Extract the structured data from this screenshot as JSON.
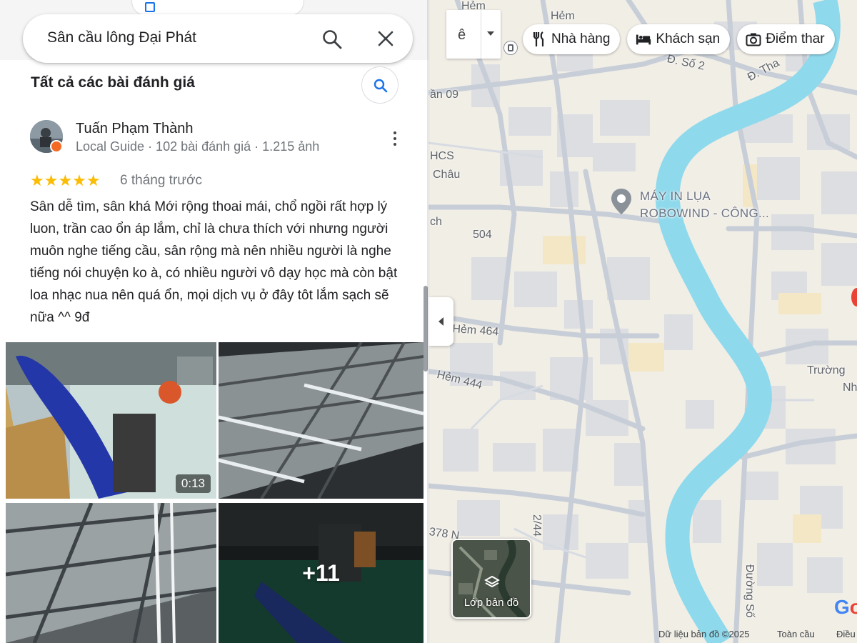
{
  "search": {
    "value": "Sân cầu lông Đại Phát"
  },
  "peek_tab_label": "",
  "reviews": {
    "section_title": "Tất cả các bài đánh giá",
    "review": {
      "author": "Tuấn Phạm Thành",
      "meta": "Local Guide · 102 bài đánh giá · 1.215 ảnh",
      "rating": 5,
      "stars": "★★★★★",
      "date": "6 tháng trước",
      "text": "Sân dễ tìm, sân khá Mới rộng thoai mái, chổ ngồi rất hợp lý luon, trần cao ổn áp lắm, chỉ là chưa thích với nhưng người muôn nghe tiếng cầu, sân rộng mà nên nhiều người là nghe tiếng nói chuyện ko à, có nhiều người vô dạy học mà còn bật loa nhạc nua nên quá ổn, mọi dịch vụ ở đây tôt lắm sạch sẽ nữa ^^ 9đ",
      "photos": {
        "video_duration": "0:13",
        "more_count": "+11"
      }
    }
  },
  "map": {
    "lang_button": "ê",
    "chips": [
      {
        "label": "Nhà hàng",
        "icon": "restaurant-icon"
      },
      {
        "label": "Khách sạn",
        "icon": "hotel-icon"
      },
      {
        "label": "Điểm thar",
        "icon": "camera-icon"
      }
    ],
    "poi_label_line1": "MÁY IN LỤA",
    "poi_label_line2": "ROBOWIND - CÔNG...",
    "labels": {
      "hem_top": "Hẻm",
      "hem_top2": "Hẻm",
      "so2": "Đ. Số 2",
      "than": "Đ. Tha",
      "an09": "ần 09",
      "hcs": "HCS",
      "chau": "Châu",
      "ch": "ch",
      "n504": "504",
      "hem464": "Hẻm 464",
      "hem444": "Hẻm 444",
      "truong": "Trường",
      "nh": "Nh",
      "n378": "378 N",
      "n2744": "2/44",
      "duongso": "Đường Số"
    },
    "layers_label": "Lớp bản đồ",
    "google": [
      "G",
      "o"
    ],
    "footer": {
      "data": "Dữ liệu bản đồ ©2025",
      "global": "Toàn cầu",
      "terms": "Điều"
    },
    "colors": {
      "river": "#8fd9ec",
      "road": "#c9cfd7",
      "building": "#dbdde1",
      "land": "#f1eee6"
    }
  }
}
